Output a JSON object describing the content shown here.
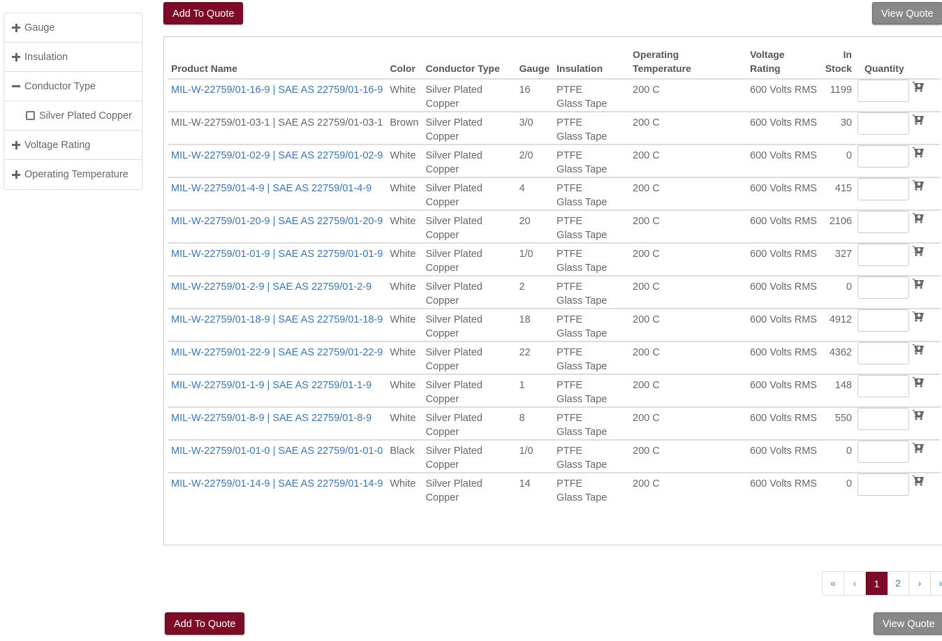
{
  "top_bar": {
    "add_label": "Add To Quote",
    "view_label": "View Quote"
  },
  "bottom_bar": {
    "add_label": "Add To Quote",
    "view_label": "View Quote"
  },
  "sidebar": {
    "facets": [
      {
        "label": "Gauge",
        "state": "collapsed"
      },
      {
        "label": "Insulation",
        "state": "collapsed"
      },
      {
        "label": "Conductor Type",
        "state": "expanded"
      },
      {
        "label": "Silver Plated Copper",
        "state": "option"
      },
      {
        "label": "Voltage Rating",
        "state": "collapsed"
      },
      {
        "label": "Operating Temperature",
        "state": "collapsed"
      }
    ]
  },
  "table": {
    "headers": {
      "product_name": "Product Name",
      "color": "Color",
      "conductor_type": "Conductor Type",
      "gauge": "Gauge",
      "insulation": "Insulation",
      "operating_temperature": "Operating Temperature",
      "voltage_rating": "Voltage Rating",
      "in_stock": "In Stock",
      "quantity": "Quantity"
    },
    "rows": [
      {
        "name": "MIL-W-22759/01-16-9 | SAE AS 22759/01-16-9",
        "linked": true,
        "color": "White",
        "conductor": "Silver Plated Copper",
        "gauge": "16",
        "insulation": "PTFE Glass Tape",
        "temp": "200 C",
        "voltage": "600 Volts RMS",
        "stock": "1199"
      },
      {
        "name": "MIL-W-22759/01-03-1 | SAE AS 22759/01-03-1",
        "linked": false,
        "color": "Brown",
        "conductor": "Silver Plated Copper",
        "gauge": "3/0",
        "insulation": "PTFE Glass Tape",
        "temp": "200 C",
        "voltage": "600 Volts RMS",
        "stock": "30"
      },
      {
        "name": "MIL-W-22759/01-02-9 | SAE AS 22759/01-02-9",
        "linked": true,
        "color": "White",
        "conductor": "Silver Plated Copper",
        "gauge": "2/0",
        "insulation": "PTFE Glass Tape",
        "temp": "200 C",
        "voltage": "600 Volts RMS",
        "stock": "0"
      },
      {
        "name": "MIL-W-22759/01-4-9 | SAE AS 22759/01-4-9",
        "linked": true,
        "color": "White",
        "conductor": "Silver Plated Copper",
        "gauge": "4",
        "insulation": "PTFE Glass Tape",
        "temp": "200 C",
        "voltage": "600 Volts RMS",
        "stock": "415"
      },
      {
        "name": "MIL-W-22759/01-20-9 | SAE AS 22759/01-20-9",
        "linked": true,
        "color": "White",
        "conductor": "Silver Plated Copper",
        "gauge": "20",
        "insulation": "PTFE Glass Tape",
        "temp": "200 C",
        "voltage": "600 Volts RMS",
        "stock": "2106"
      },
      {
        "name": "MIL-W-22759/01-01-9 | SAE AS 22759/01-01-9",
        "linked": true,
        "color": "White",
        "conductor": "Silver Plated Copper",
        "gauge": "1/0",
        "insulation": "PTFE Glass Tape",
        "temp": "200 C",
        "voltage": "600 Volts RMS",
        "stock": "327"
      },
      {
        "name": "MIL-W-22759/01-2-9 | SAE AS 22759/01-2-9",
        "linked": true,
        "color": "White",
        "conductor": "Silver Plated Copper",
        "gauge": "2",
        "insulation": "PTFE Glass Tape",
        "temp": "200 C",
        "voltage": "600 Volts RMS",
        "stock": "0"
      },
      {
        "name": "MIL-W-22759/01-18-9 | SAE AS 22759/01-18-9",
        "linked": true,
        "color": "White",
        "conductor": "Silver Plated Copper",
        "gauge": "18",
        "insulation": "PTFE Glass Tape",
        "temp": "200 C",
        "voltage": "600 Volts RMS",
        "stock": "4912"
      },
      {
        "name": "MIL-W-22759/01-22-9 | SAE AS 22759/01-22-9",
        "linked": true,
        "color": "White",
        "conductor": "Silver Plated Copper",
        "gauge": "22",
        "insulation": "PTFE Glass Tape",
        "temp": "200 C",
        "voltage": "600 Volts RMS",
        "stock": "4362"
      },
      {
        "name": "MIL-W-22759/01-1-9 | SAE AS 22759/01-1-9",
        "linked": true,
        "color": "White",
        "conductor": "Silver Plated Copper",
        "gauge": "1",
        "insulation": "PTFE Glass Tape",
        "temp": "200 C",
        "voltage": "600 Volts RMS",
        "stock": "148"
      },
      {
        "name": "MIL-W-22759/01-8-9 | SAE AS 22759/01-8-9",
        "linked": true,
        "color": "White",
        "conductor": "Silver Plated Copper",
        "gauge": "8",
        "insulation": "PTFE Glass Tape",
        "temp": "200 C",
        "voltage": "600 Volts RMS",
        "stock": "550"
      },
      {
        "name": "MIL-W-22759/01-01-0 | SAE AS 22759/01-01-0",
        "linked": true,
        "color": "Black",
        "conductor": "Silver Plated Copper",
        "gauge": "1/0",
        "insulation": "PTFE Glass Tape",
        "temp": "200 C",
        "voltage": "600 Volts RMS",
        "stock": "0"
      },
      {
        "name": "MIL-W-22759/01-14-9 | SAE AS 22759/01-14-9",
        "linked": true,
        "color": "White",
        "conductor": "Silver Plated Copper",
        "gauge": "14",
        "insulation": "PTFE Glass Tape",
        "temp": "200 C",
        "voltage": "600 Volts RMS",
        "stock": "0"
      }
    ]
  },
  "pagination": {
    "first": "«",
    "prev": "‹",
    "pages": [
      "1",
      "2"
    ],
    "current": "1",
    "next": "›",
    "last": "»"
  },
  "colors": {
    "accent": "#7d0a26",
    "link": "#3a75b0",
    "gray_button": "#888888"
  },
  "icons": {
    "facet_collapsed": "plus-icon",
    "facet_expanded": "minus-icon",
    "row_action": "cart-plus-icon"
  }
}
